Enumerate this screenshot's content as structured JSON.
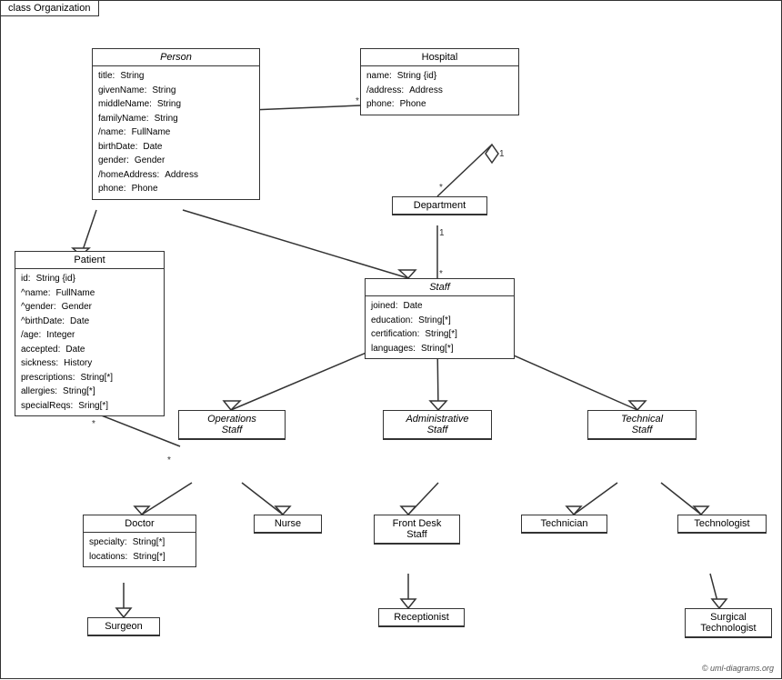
{
  "diagram": {
    "title": "class Organization",
    "copyright": "© uml-diagrams.org",
    "classes": {
      "Person": {
        "title": "Person",
        "italic": true,
        "attrs": [
          {
            "name": "title:",
            "type": "String"
          },
          {
            "name": "givenName:",
            "type": "String"
          },
          {
            "name": "middleName:",
            "type": "String"
          },
          {
            "name": "familyName:",
            "type": "String"
          },
          {
            "name": "/name:",
            "type": "FullName"
          },
          {
            "name": "birthDate:",
            "type": "Date"
          },
          {
            "name": "gender:",
            "type": "Gender"
          },
          {
            "name": "/homeAddress:",
            "type": "Address"
          },
          {
            "name": "phone:",
            "type": "Phone"
          }
        ]
      },
      "Hospital": {
        "title": "Hospital",
        "attrs": [
          {
            "name": "name:",
            "type": "String {id}"
          },
          {
            "name": "/address:",
            "type": "Address"
          },
          {
            "name": "phone:",
            "type": "Phone"
          }
        ]
      },
      "Department": {
        "title": "Department",
        "attrs": []
      },
      "Staff": {
        "title": "Staff",
        "italic": true,
        "attrs": [
          {
            "name": "joined:",
            "type": "Date"
          },
          {
            "name": "education:",
            "type": "String[*]"
          },
          {
            "name": "certification:",
            "type": "String[*]"
          },
          {
            "name": "languages:",
            "type": "String[*]"
          }
        ]
      },
      "Patient": {
        "title": "Patient",
        "attrs": [
          {
            "name": "id:",
            "type": "String {id}"
          },
          {
            "name": "^name:",
            "type": "FullName"
          },
          {
            "name": "^gender:",
            "type": "Gender"
          },
          {
            "name": "^birthDate:",
            "type": "Date"
          },
          {
            "name": "/age:",
            "type": "Integer"
          },
          {
            "name": "accepted:",
            "type": "Date"
          },
          {
            "name": "sickness:",
            "type": "History"
          },
          {
            "name": "prescriptions:",
            "type": "String[*]"
          },
          {
            "name": "allergies:",
            "type": "String[*]"
          },
          {
            "name": "specialReqs:",
            "type": "Sring[*]"
          }
        ]
      },
      "OperationsStaff": {
        "title": "Operations Staff",
        "italic": true,
        "attrs": []
      },
      "AdministrativeStaff": {
        "title": "Administrative Staff",
        "italic": true,
        "attrs": []
      },
      "TechnicalStaff": {
        "title": "Technical Staff",
        "italic": true,
        "attrs": []
      },
      "Doctor": {
        "title": "Doctor",
        "attrs": [
          {
            "name": "specialty:",
            "type": "String[*]"
          },
          {
            "name": "locations:",
            "type": "String[*]"
          }
        ]
      },
      "Nurse": {
        "title": "Nurse",
        "attrs": []
      },
      "FrontDeskStaff": {
        "title": "Front Desk Staff",
        "attrs": []
      },
      "Technician": {
        "title": "Technician",
        "attrs": []
      },
      "Technologist": {
        "title": "Technologist",
        "attrs": []
      },
      "Surgeon": {
        "title": "Surgeon",
        "attrs": []
      },
      "Receptionist": {
        "title": "Receptionist",
        "attrs": []
      },
      "SurgicalTechnologist": {
        "title": "Surgical Technologist",
        "attrs": []
      }
    }
  }
}
